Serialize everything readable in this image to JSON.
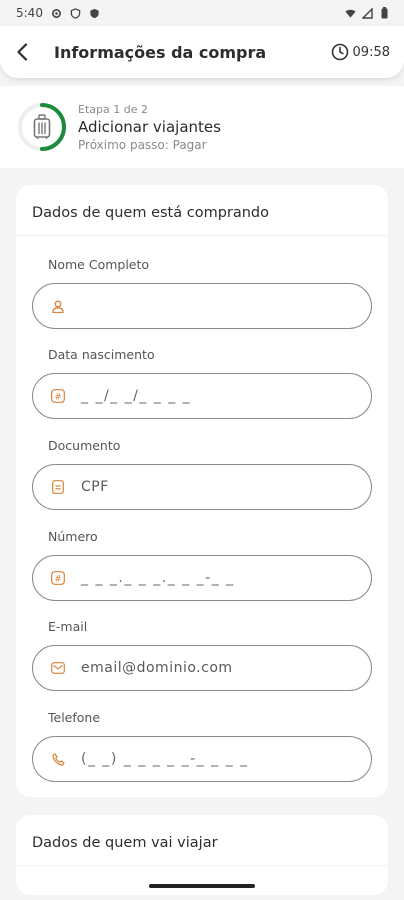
{
  "status_bar": {
    "time": "5:40",
    "left_icons": [
      "settings-icon",
      "shield-icon",
      "shield-icon"
    ],
    "right_icons": [
      "wifi-icon",
      "signal-icon",
      "battery-icon"
    ]
  },
  "header": {
    "title": "Informações da compra",
    "timer": "09:58"
  },
  "stepper": {
    "step_count": "Etapa 1 de 2",
    "title": "Adicionar viajantes",
    "next": "Próximo passo: Pagar",
    "progress": 0.5
  },
  "buyer_section": {
    "title": "Dados de quem está comprando",
    "fields": [
      {
        "label": "Nome Completo",
        "value": "",
        "icon": "user-icon"
      },
      {
        "label": "Data nascimento",
        "value": "_ _/_ _/_ _ _ _",
        "icon": "hash-icon"
      },
      {
        "label": "Documento",
        "value": "CPF",
        "icon": "document-icon"
      },
      {
        "label": "Número",
        "value": "_ _ _._ _ _._ _ _-_ _",
        "icon": "hash-icon"
      },
      {
        "label": "E-mail",
        "placeholder": "email@dominio.com",
        "icon": "mail-icon"
      },
      {
        "label": "Telefone",
        "value": "(_ _) _ _ _ _ _-_ _ _ _",
        "icon": "phone-icon"
      }
    ]
  },
  "travelers_section": {
    "title": "Dados de quem vai viajar"
  },
  "colors": {
    "accent_green": "#1f8a3c",
    "icon_orange": "#d9823a",
    "field_border": "#8a8a8a"
  }
}
